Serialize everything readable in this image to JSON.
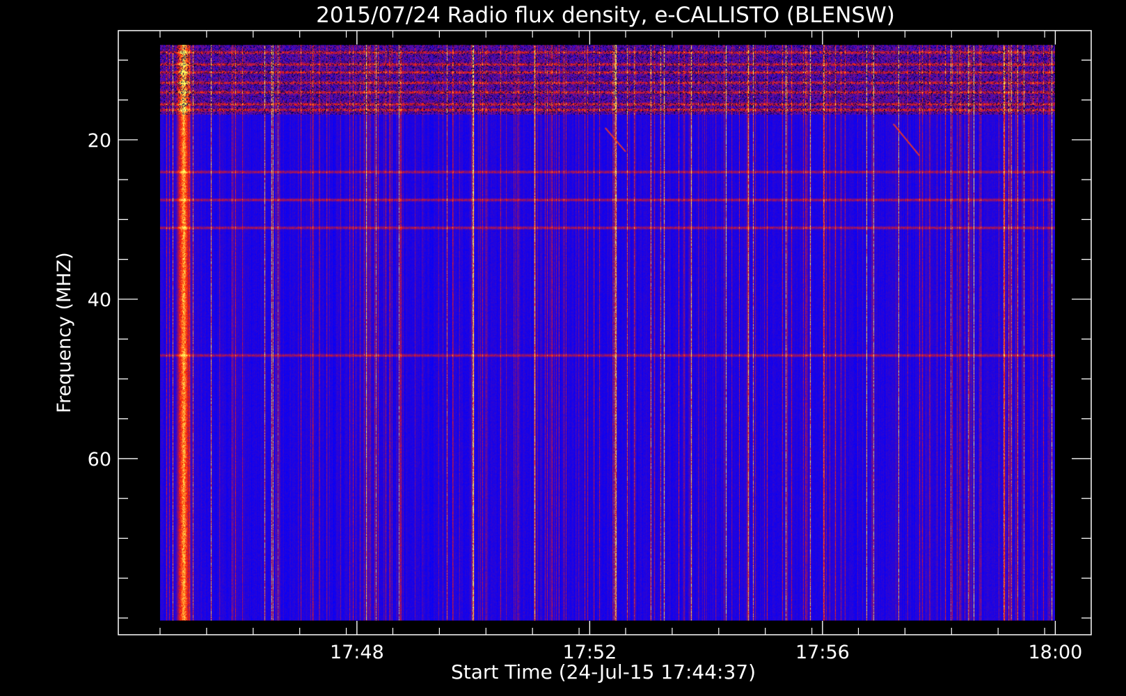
{
  "chart_data": {
    "type": "heatmap",
    "title": "2015/07/24  Radio flux density, e-CALLISTO (BLENSW)",
    "xlabel": "Start Time (24-Jul-15 17:44:37)",
    "ylabel": "Frequency (MHZ)",
    "x_ticks": [
      {
        "label": "17:48",
        "minutes": 3.383
      },
      {
        "label": "17:52",
        "minutes": 7.383
      },
      {
        "label": "17:56",
        "minutes": 11.383
      },
      {
        "label": "18:00",
        "minutes": 15.383
      }
    ],
    "x_minor_step_minutes": 0.8,
    "y_ticks": [
      {
        "label": "20",
        "value": 20
      },
      {
        "label": "40",
        "value": 40
      },
      {
        "label": "60",
        "value": 60
      }
    ],
    "y_minor_step": 5,
    "xlim_minutes": [
      -0.717,
      16.0
    ],
    "data_x_range_minutes": [
      0,
      15.383
    ],
    "ylim": [
      6.3,
      82.1
    ],
    "y_inverted": true,
    "data_freq_range_mhz": [
      8.1,
      80.3
    ],
    "colormap": {
      "low": "#0000ff",
      "mid": "#ff2000",
      "high": "#ffff60",
      "dark": "#000033"
    },
    "features": {
      "bright_burst_column_minutes": 0.4,
      "rfi_bands_mhz": [
        9.0,
        10.5,
        11.5,
        12.8,
        14.0,
        15.5,
        16.2,
        24.0,
        27.5,
        31.0,
        47.0
      ],
      "drifting_features": [
        {
          "t0": 7.65,
          "f0": 18.5,
          "t1": 8.0,
          "f1": 21.5
        },
        {
          "t0": 12.6,
          "f0": 18.0,
          "t1": 13.05,
          "f1": 22.0
        }
      ]
    }
  }
}
